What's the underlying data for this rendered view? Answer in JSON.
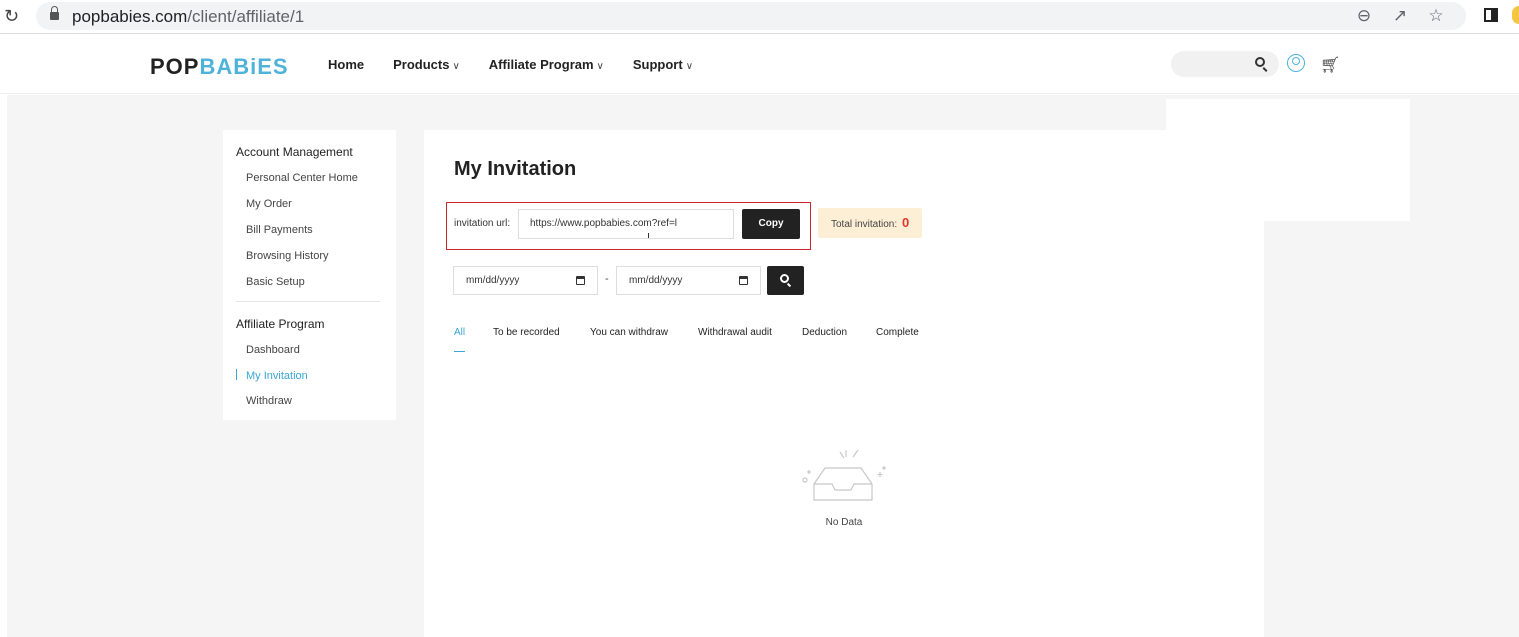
{
  "browser": {
    "url_host": "popbabies.com",
    "url_path": "/client/affiliate/1"
  },
  "header": {
    "logo_part1": "POP",
    "logo_part2": "BABiES",
    "nav": [
      "Home",
      "Products",
      "Affiliate Program",
      "Support"
    ]
  },
  "sidebar": {
    "section1_title": "Account Management",
    "section1_items": [
      "Personal Center Home",
      "My Order",
      "Bill Payments",
      "Browsing History",
      "Basic Setup"
    ],
    "section2_title": "Affiliate Program",
    "section2_items": [
      "Dashboard",
      "My Invitation",
      "Withdraw"
    ],
    "active_item": "My Invitation"
  },
  "main": {
    "title": "My Invitation",
    "invitation_label": "invitation url:",
    "invitation_value": "https://www.popbabies.com?ref=l",
    "copy_label": "Copy",
    "total_label": "Total invitation:",
    "total_count": "0",
    "date_from_placeholder": "mm/dd/yyyy",
    "date_to_placeholder": "mm/dd/yyyy",
    "date_separator": "-",
    "tabs": [
      "All",
      "To be recorded",
      "You can withdraw",
      "Withdrawal audit",
      "Deduction",
      "Complete"
    ],
    "active_tab": "All",
    "empty_text": "No Data"
  },
  "colors": {
    "accent": "#3aa5d6",
    "highlight_border": "#c9262e",
    "badge_bg": "#fdefd6",
    "count_red": "#e5352a"
  }
}
